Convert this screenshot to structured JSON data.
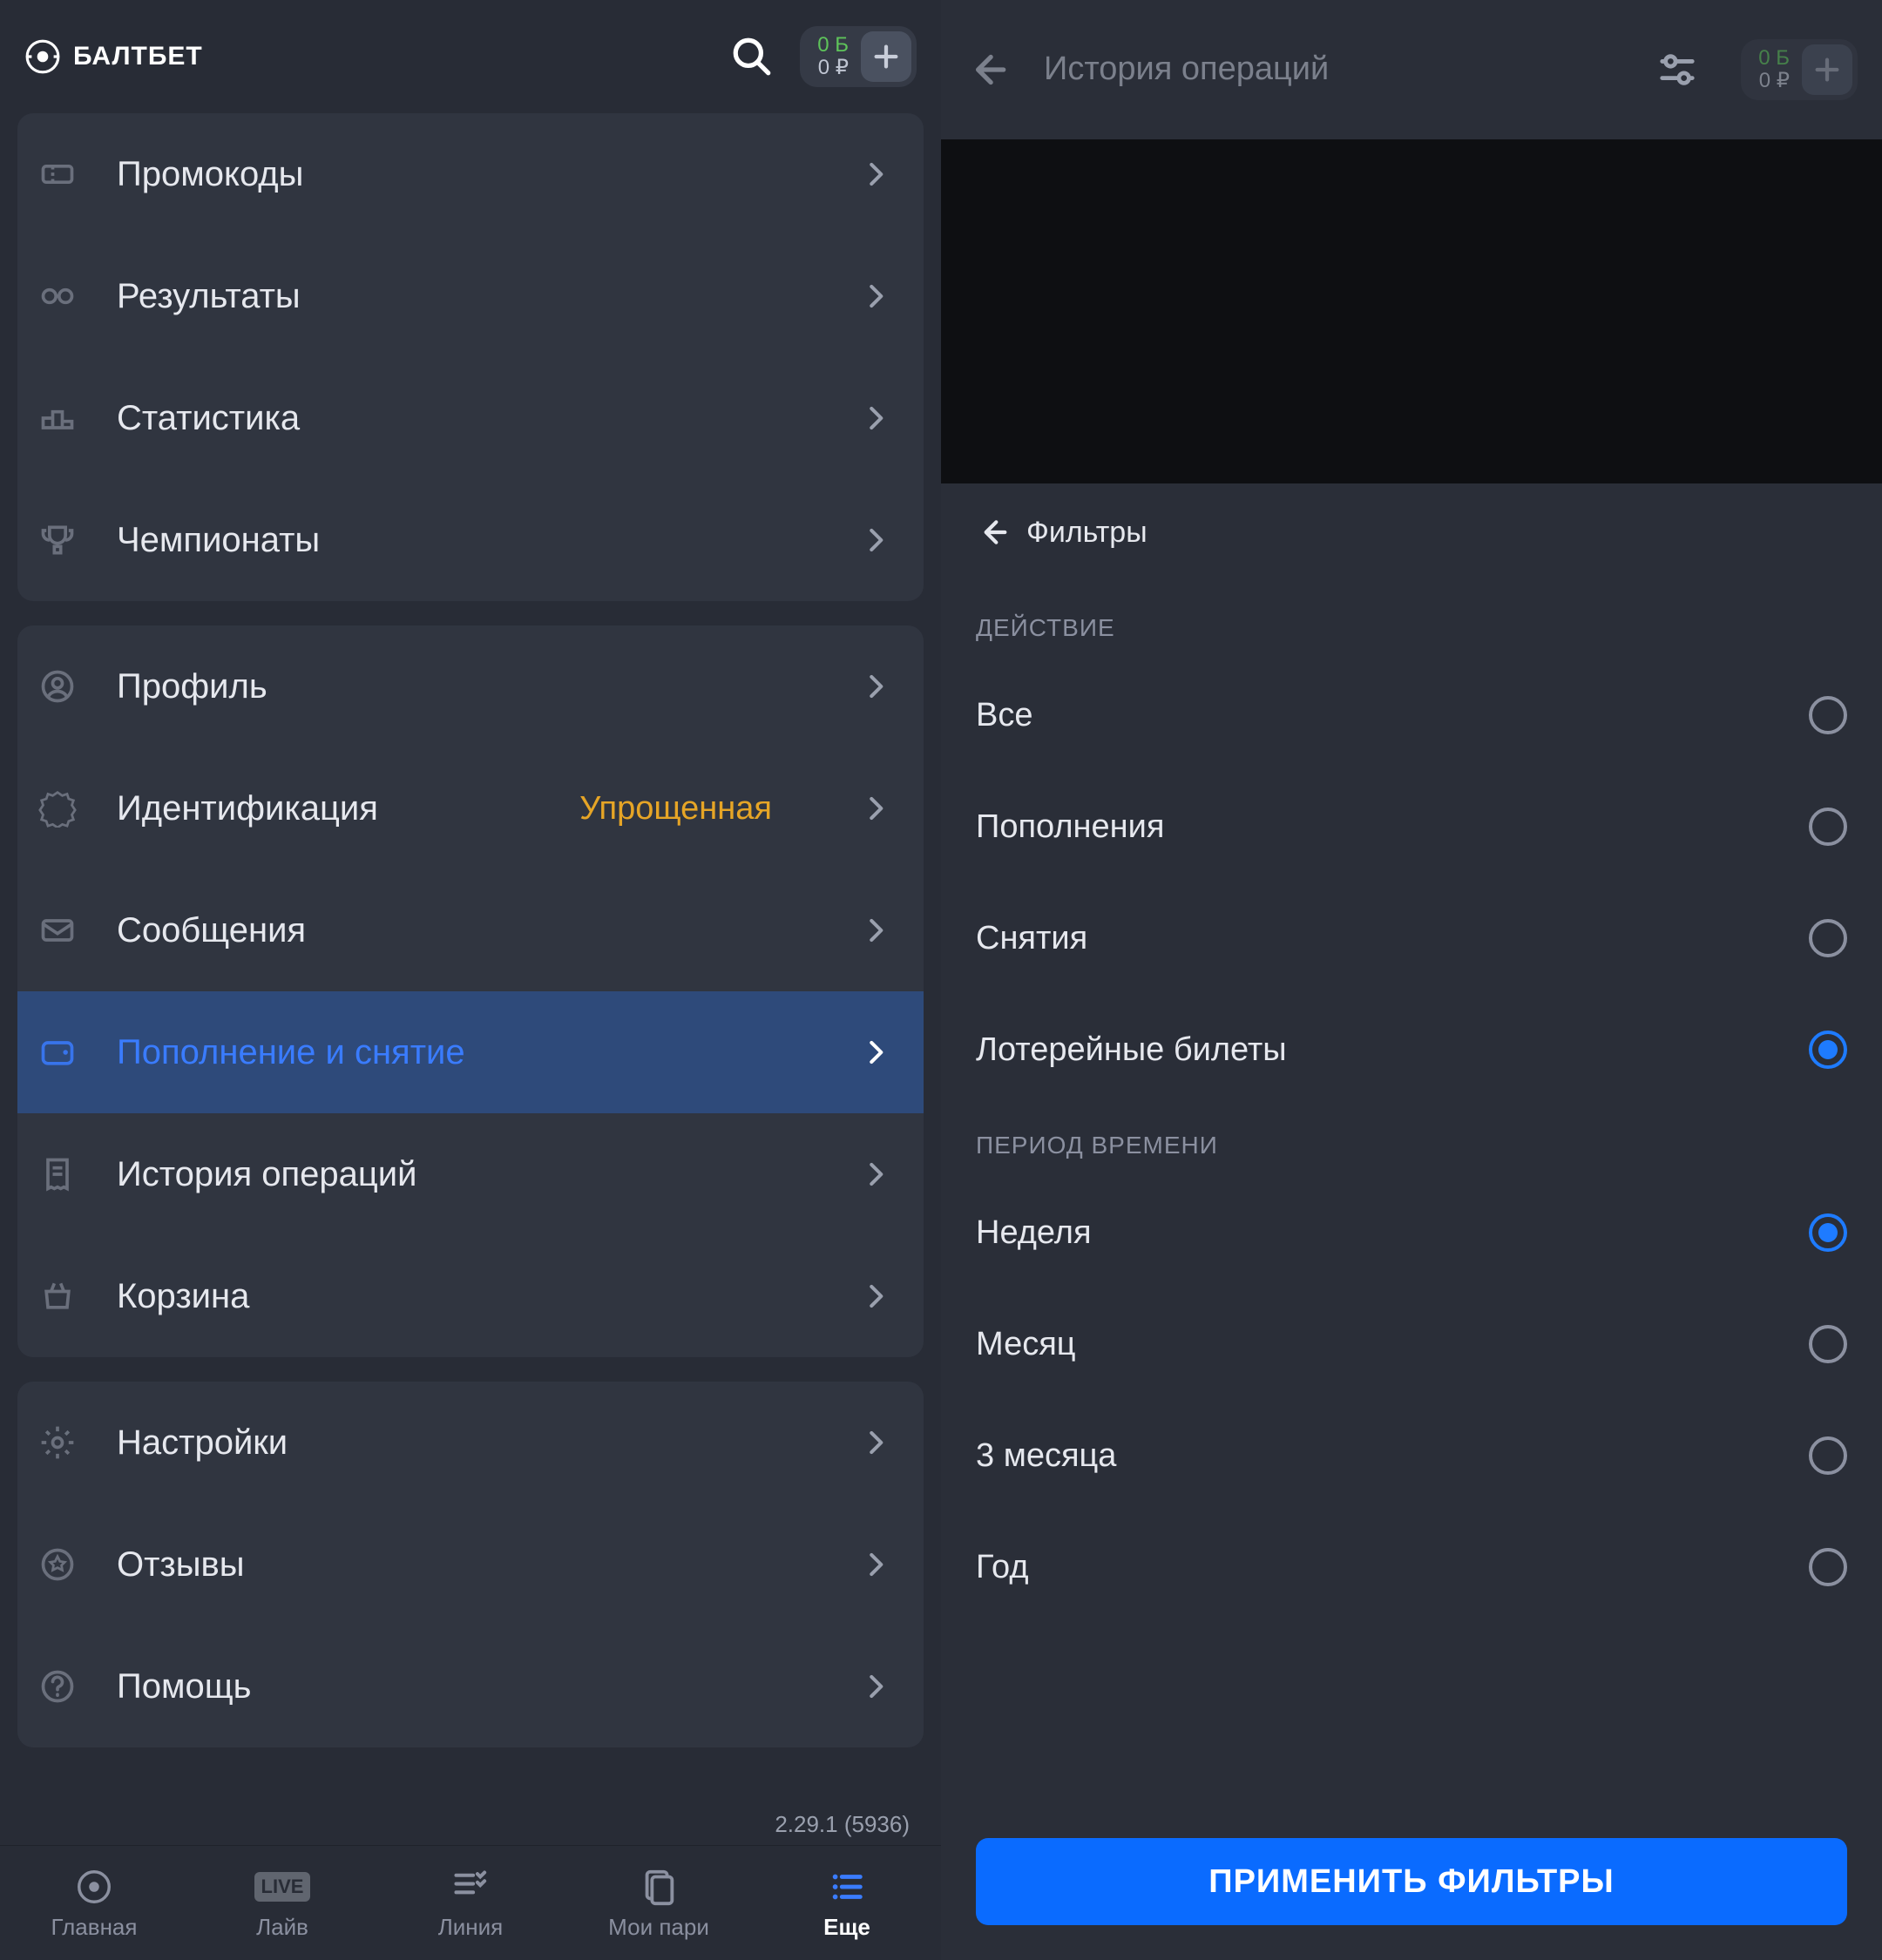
{
  "left": {
    "brand": "БАЛТБЕТ",
    "balance_bonus": "0 Б",
    "balance_main": "0 ₽",
    "groups": [
      {
        "items": [
          {
            "id": "promo",
            "label": "Промокоды",
            "icon": "ticket"
          },
          {
            "id": "results",
            "label": "Результаты",
            "icon": "glasses"
          },
          {
            "id": "stats",
            "label": "Статистика",
            "icon": "podium"
          },
          {
            "id": "champ",
            "label": "Чемпионаты",
            "icon": "trophy"
          }
        ]
      },
      {
        "items": [
          {
            "id": "profile",
            "label": "Профиль",
            "icon": "user"
          },
          {
            "id": "ident",
            "label": "Идентификация",
            "icon": "badge",
            "badge": "Упрощенная"
          },
          {
            "id": "msgs",
            "label": "Сообщения",
            "icon": "mail"
          },
          {
            "id": "wallet",
            "label": "Пополнение и снятие",
            "icon": "wallet",
            "active": true
          },
          {
            "id": "history",
            "label": "История операций",
            "icon": "receipt"
          },
          {
            "id": "cart",
            "label": "Корзина",
            "icon": "basket"
          }
        ]
      },
      {
        "items": [
          {
            "id": "settings",
            "label": "Настройки",
            "icon": "gear"
          },
          {
            "id": "reviews",
            "label": "Отзывы",
            "icon": "star"
          },
          {
            "id": "help",
            "label": "Помощь",
            "icon": "question"
          }
        ]
      }
    ],
    "version": "2.29.1 (5936)",
    "tabs": [
      {
        "id": "home",
        "label": "Главная",
        "icon": "logo"
      },
      {
        "id": "live",
        "label": "Лайв",
        "icon": "live"
      },
      {
        "id": "line",
        "label": "Линия",
        "icon": "list-check"
      },
      {
        "id": "bets",
        "label": "Мои пари",
        "icon": "papers"
      },
      {
        "id": "more",
        "label": "Еще",
        "icon": "menu-list",
        "active": true
      }
    ]
  },
  "right": {
    "title": "История операций",
    "balance_bonus": "0 Б",
    "balance_main": "0 ₽",
    "filters_label": "Фильтры",
    "section_action": "ДЕЙСТВИЕ",
    "actions": [
      {
        "id": "all",
        "label": "Все"
      },
      {
        "id": "dep",
        "label": "Пополнения"
      },
      {
        "id": "wd",
        "label": "Снятия"
      },
      {
        "id": "lotto",
        "label": "Лотерейные билеты",
        "selected": true
      }
    ],
    "section_period": "ПЕРИОД ВРЕМЕНИ",
    "periods": [
      {
        "id": "week",
        "label": "Неделя",
        "selected": true
      },
      {
        "id": "month",
        "label": "Месяц"
      },
      {
        "id": "3month",
        "label": "3 месяца"
      },
      {
        "id": "year",
        "label": "Год"
      }
    ],
    "apply_label": "ПРИМЕНИТЬ ФИЛЬТРЫ"
  },
  "icons": {
    "live_text": "LIVE"
  }
}
